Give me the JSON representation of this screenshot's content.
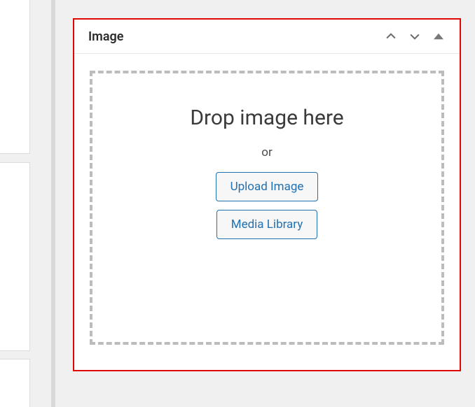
{
  "widget": {
    "title": "Image",
    "dropzone": {
      "heading": "Drop image here",
      "or": "or",
      "upload_button": "Upload Image",
      "media_library_button": "Media Library"
    }
  }
}
